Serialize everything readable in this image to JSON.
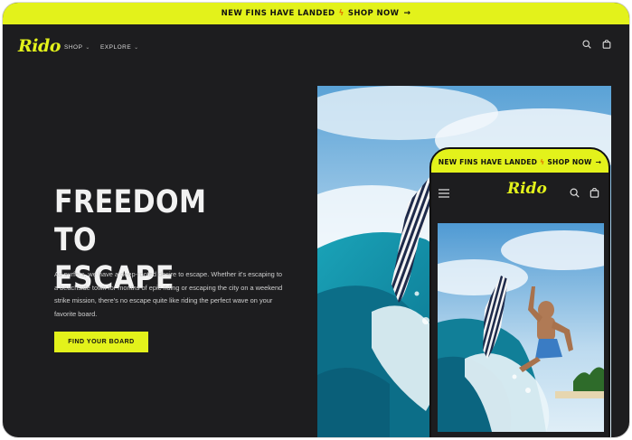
{
  "announcement": {
    "text": "NEW FINS HAVE LANDED",
    "link": "SHOP NOW",
    "flash_icon": "lightning-icon",
    "arrow_icon": "arrow-right-icon"
  },
  "brand": {
    "logo": "Rido",
    "accent": "#e3f21b",
    "background": "#1d1d1f"
  },
  "nav": {
    "items": [
      {
        "label": "SHOP",
        "icon": "chevron-down-icon"
      },
      {
        "label": "EXPLORE",
        "icon": "chevron-down-icon"
      }
    ],
    "icons": [
      "search-icon",
      "cart-icon"
    ]
  },
  "hero": {
    "title_line1": "FREEDOM TO",
    "title_line2": "ESCAPE",
    "body": "As surfers, we have a deep-rooted desire to escape. Whether it's escaping to a beachside town for months of epic riding or escaping the city on a weekend strike mission, there's no escape quite like riding the perfect wave on your favorite board.",
    "cta": "FIND YOUR BOARD"
  },
  "mobile": {
    "announcement_text": "NEW FINS HAVE LANDED",
    "announcement_link": "SHOP NOW",
    "logo": "Rido",
    "icons": [
      "menu-icon",
      "search-icon",
      "cart-icon"
    ]
  }
}
